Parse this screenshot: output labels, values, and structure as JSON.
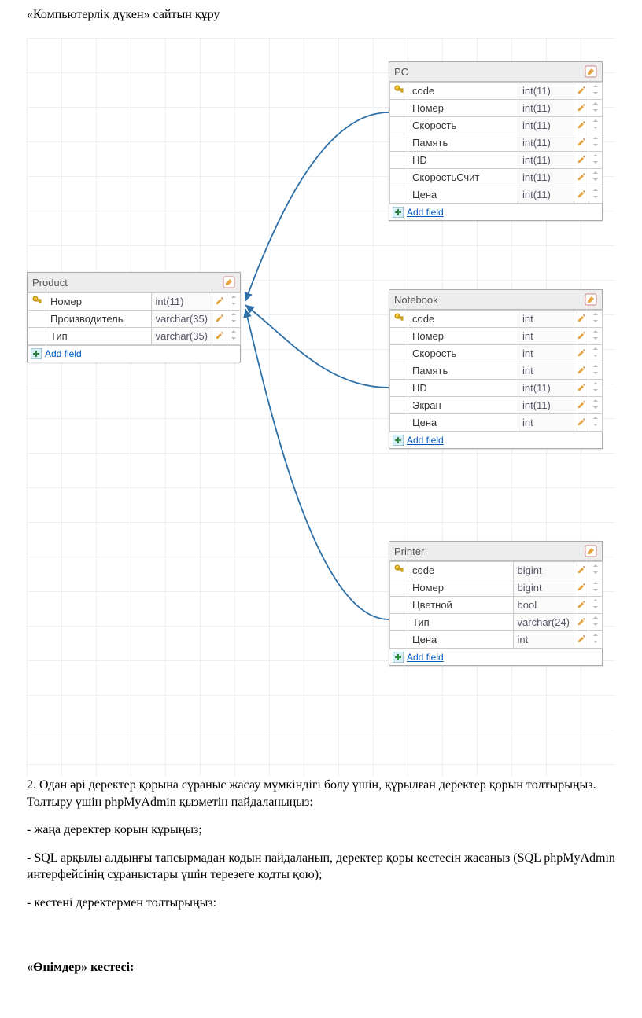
{
  "page": {
    "title": "«Компьютерлік дүкен» сайтын құру",
    "add_field": "Add field",
    "body_p1": "2. Одан әрі деректер қорына сұраныс жасау мүмкіндігі болу үшін, құрылған деректер қорын толтырыңыз. Толтыру үшін phpMyAdmin қызметін пайдаланыңыз:",
    "body_l1": "- жаңа деректер қорын құрыңыз;",
    "body_l2": "- SQL арқылы алдыңғы тапсырмадан кодын пайдаланып, деректер қоры кестесін жасаңыз (SQL phpMyAdmin интерфейсінің сұраныстары үшін терезеге кодты қою);",
    "body_l3": "- кестені деректермен толтырыңыз:",
    "subhead": "«Өнімдер» кестесі:"
  },
  "tables": {
    "product": {
      "title": "Product",
      "fields": [
        {
          "key": true,
          "name": "Номер",
          "type": "int(11)"
        },
        {
          "key": false,
          "name": "Производитель",
          "type": "varchar(35)"
        },
        {
          "key": false,
          "name": "Тип",
          "type": "varchar(35)"
        }
      ]
    },
    "pc": {
      "title": "PC",
      "fields": [
        {
          "key": true,
          "name": "code",
          "type": "int(11)"
        },
        {
          "key": false,
          "name": "Номер",
          "type": "int(11)"
        },
        {
          "key": false,
          "name": "Скорость",
          "type": "int(11)"
        },
        {
          "key": false,
          "name": "Память",
          "type": "int(11)"
        },
        {
          "key": false,
          "name": "HD",
          "type": "int(11)"
        },
        {
          "key": false,
          "name": "СкоростьСчит",
          "type": "int(11)"
        },
        {
          "key": false,
          "name": "Цена",
          "type": "int(11)"
        }
      ]
    },
    "notebook": {
      "title": "Notebook",
      "fields": [
        {
          "key": true,
          "name": "code",
          "type": "int"
        },
        {
          "key": false,
          "name": "Номер",
          "type": "int"
        },
        {
          "key": false,
          "name": "Скорость",
          "type": "int"
        },
        {
          "key": false,
          "name": "Память",
          "type": "int"
        },
        {
          "key": false,
          "name": "HD",
          "type": "int(11)"
        },
        {
          "key": false,
          "name": "Экран",
          "type": "int(11)"
        },
        {
          "key": false,
          "name": "Цена",
          "type": "int"
        }
      ]
    },
    "printer": {
      "title": "Printer",
      "fields": [
        {
          "key": true,
          "name": "code",
          "type": "bigint"
        },
        {
          "key": false,
          "name": "Номер",
          "type": "bigint"
        },
        {
          "key": false,
          "name": "Цветной",
          "type": "bool"
        },
        {
          "key": false,
          "name": "Тип",
          "type": "varchar(24)"
        },
        {
          "key": false,
          "name": "Цена",
          "type": "int"
        }
      ]
    }
  }
}
